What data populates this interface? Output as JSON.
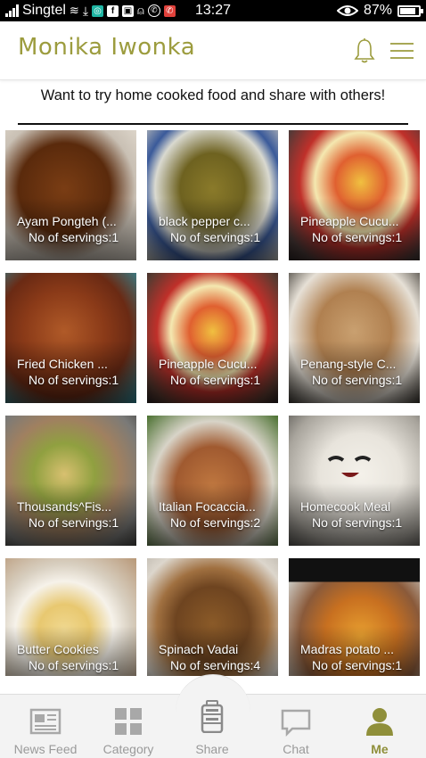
{
  "status": {
    "carrier": "Singtel",
    "time": "13:27",
    "battery": "87%",
    "battery_level": 0.87
  },
  "header": {
    "title": "Monika Iwonka",
    "accent": "#9c9c3e"
  },
  "intro": "Want to try home cooked food and share with others!",
  "cards": [
    {
      "name": "Ayam Pongteh (...",
      "servings": "No of servings:1"
    },
    {
      "name": "black pepper c...",
      "servings": "No of servings:1"
    },
    {
      "name": "Pineapple Cucu...",
      "servings": "No of servings:1"
    },
    {
      "name": "Fried Chicken ...",
      "servings": "No of servings:1"
    },
    {
      "name": "Pineapple Cucu...",
      "servings": "No of servings:1"
    },
    {
      "name": "Penang-style C...",
      "servings": "No of servings:1"
    },
    {
      "name": "Thousands^Fis...",
      "servings": "No of servings:1"
    },
    {
      "name": "Italian Focaccia...",
      "servings": "No of servings:2"
    },
    {
      "name": "Homecook Meal",
      "servings": "No of servings:1"
    },
    {
      "name": "Butter Cookies",
      "servings": "No of servings:1"
    },
    {
      "name": "Spinach Vadai",
      "servings": "No of servings:4"
    },
    {
      "name": "Madras potato ...",
      "servings": "No of servings:1"
    }
  ],
  "nav": {
    "news_feed": "News Feed",
    "category": "Category",
    "share": "Share",
    "chat": "Chat",
    "me": "Me"
  }
}
